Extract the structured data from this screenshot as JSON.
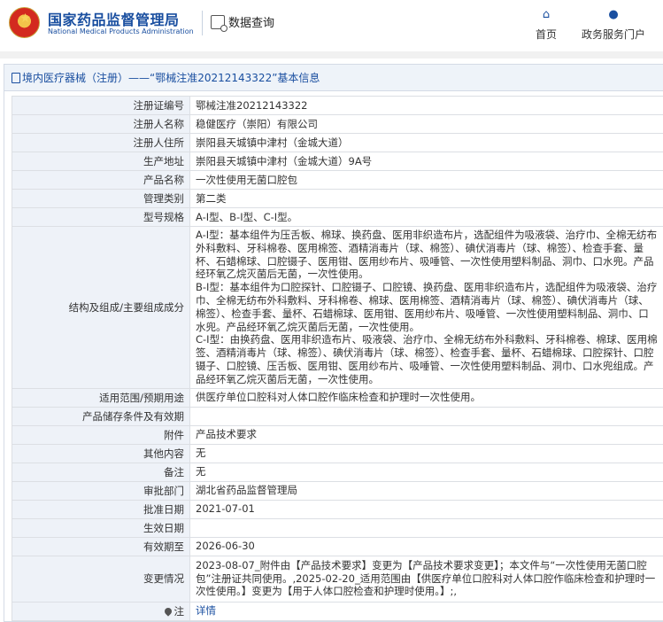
{
  "header": {
    "brand_cn": "国家药品监督管理局",
    "brand_en": "National Medical Products Administration",
    "query_label": "数据查询",
    "nav": [
      {
        "label": "首页",
        "icon": "home-icon"
      },
      {
        "label": "政务服务门户",
        "icon": "user-icon"
      }
    ]
  },
  "panel": {
    "title": "境内医疗器械（注册）——“鄂械注准20212143322”基本信息"
  },
  "rows": [
    {
      "label": "注册证编号",
      "value": "鄂械注准20212143322"
    },
    {
      "label": "注册人名称",
      "value": "稳健医疗（崇阳）有限公司"
    },
    {
      "label": "注册人住所",
      "value": "崇阳县天城镇中津村（金城大道）"
    },
    {
      "label": "生产地址",
      "value": "崇阳县天城镇中津村（金城大道）9A号"
    },
    {
      "label": "产品名称",
      "value": "一次性使用无菌口腔包"
    },
    {
      "label": "管理类别",
      "value": "第二类"
    },
    {
      "label": "型号规格",
      "value": "A-Ⅰ型、B-Ⅰ型、C-Ⅰ型。"
    },
    {
      "label": "结构及组成/主要组成成分",
      "value": "A-Ⅰ型：基本组件为压舌板、棉球、换药盘、医用非织造布片，选配组件为吸液袋、治疗巾、全棉无纺布外科敷料、牙科棉卷、医用棉签、酒精消毒片（球、棉签）、碘伏消毒片（球、棉签）、检查手套、量杯、石蜡棉球、口腔镊子、医用钳、医用纱布片、吸唾管、一次性使用塑料制品、洞巾、口水兜。产品经环氧乙烷灭菌后无菌，一次性使用。\nB-Ⅰ型：基本组件为口腔探针、口腔镊子、口腔镜、换药盘、医用非织造布片，选配组件为吸液袋、治疗巾、全棉无纺布外科敷料、牙科棉卷、棉球、医用棉签、酒精消毒片（球、棉签）、碘伏消毒片（球、棉签）、检查手套、量杯、石蜡棉球、医用钳、医用纱布片、吸唾管、一次性使用塑料制品、洞巾、口水兜。产品经环氧乙烷灭菌后无菌，一次性使用。\nC-Ⅰ型：由换药盘、医用非织造布片、吸液袋、治疗巾、全棉无纺布外科敷料、牙科棉卷、棉球、医用棉签、酒精消毒片（球、棉签）、碘伏消毒片（球、棉签）、检查手套、量杯、石蜡棉球、口腔探针、口腔镊子、口腔镜、压舌板、医用钳、医用纱布片、吸唾管、一次性使用塑料制品、洞巾、口水兜组成。产品经环氧乙烷灭菌后无菌，一次性使用。"
    },
    {
      "label": "适用范围/预期用途",
      "value": "供医疗单位口腔科对人体口腔作临床检查和护理时一次性使用。"
    },
    {
      "label": "产品储存条件及有效期",
      "value": ""
    },
    {
      "label": "附件",
      "value": "产品技术要求"
    },
    {
      "label": "其他内容",
      "value": "无"
    },
    {
      "label": "备注",
      "value": "无"
    },
    {
      "label": "审批部门",
      "value": "湖北省药品监督管理局"
    },
    {
      "label": "批准日期",
      "value": "2021-07-01"
    },
    {
      "label": "生效日期",
      "value": ""
    },
    {
      "label": "有效期至",
      "value": "2026-06-30"
    },
    {
      "label": "变更情况",
      "value": "2023-08-07_附件由【产品技术要求】变更为【产品技术要求变更】；本文件与“一次性使用无菌口腔包”注册证共同使用。,2025-02-20_适用范围由【供医疗单位口腔科对人体口腔作临床检查和护理时一次性使用。】变更为【用于人体口腔检查和护理时使用。】;,"
    },
    {
      "label": "注",
      "value": "详情"
    }
  ]
}
